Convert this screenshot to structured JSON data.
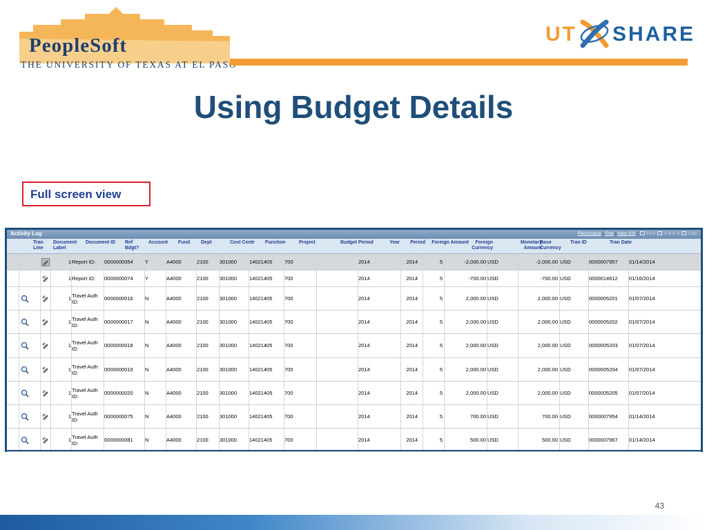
{
  "header": {
    "peoplesoft": "PeopleSoft",
    "university": "THE UNIVERSITY OF TEXAS AT EL PASO",
    "ut_share_left": "UT",
    "ut_share_right": "SHARE"
  },
  "title": "Using Budget Details",
  "callout": "Full screen view",
  "grid": {
    "title": "Activity Log",
    "nav": {
      "personalize": "Personalize",
      "find": "Find",
      "view": "View 100",
      "first": "First",
      "range": "1-9 of 9",
      "last": "Last"
    },
    "columns": [
      "Tran Line",
      "Document Label",
      "Document ID",
      "Ref Bdgt?",
      "Account",
      "Fund",
      "Dept",
      "Cost Centr",
      "Function",
      "Project",
      "Budget Period",
      "Year",
      "Period",
      "Foreign Amount",
      "Foreign Currency",
      "Monetary Amount",
      "Base Currency",
      "Tran ID",
      "Tran Date"
    ],
    "rows": [
      {
        "tran_line": "1",
        "label": "Report ID:",
        "doc_id": "0000000054",
        "ref": "Y",
        "account": "A4000",
        "fund": "2100",
        "dept": "301000",
        "cost": "14021405",
        "function": "700",
        "project": "",
        "budget_period": "2014",
        "year": "2014",
        "period": "5",
        "foreign_amount": "-2,000.00",
        "foreign_currency": "USD",
        "monetary_amount": "-2,000.00",
        "base_currency": "USD",
        "tran_id": "0000007957",
        "tran_date": "01/14/2014"
      },
      {
        "tran_line": "1",
        "label": "Report ID:",
        "doc_id": "0000000074",
        "ref": "Y",
        "account": "A4000",
        "fund": "2100",
        "dept": "301000",
        "cost": "14021405",
        "function": "700",
        "project": "",
        "budget_period": "2014",
        "year": "2014",
        "period": "5",
        "foreign_amount": "-700.00",
        "foreign_currency": "USD",
        "monetary_amount": "-700.00",
        "base_currency": "USD",
        "tran_id": "0000014612",
        "tran_date": "01/16/2014"
      },
      {
        "tran_line": "1",
        "label": "Travel Auth ID:",
        "doc_id": "0000000016",
        "ref": "N",
        "account": "A4000",
        "fund": "2100",
        "dept": "301000",
        "cost": "14021405",
        "function": "700",
        "project": "",
        "budget_period": "2014",
        "year": "2014",
        "period": "5",
        "foreign_amount": "2,000.00",
        "foreign_currency": "USD",
        "monetary_amount": "2,000.00",
        "base_currency": "USD",
        "tran_id": "0000005201",
        "tran_date": "01/07/2014"
      },
      {
        "tran_line": "1",
        "label": "Travel Auth ID:",
        "doc_id": "0000000017",
        "ref": "N",
        "account": "A4000",
        "fund": "2100",
        "dept": "301000",
        "cost": "14021405",
        "function": "700",
        "project": "",
        "budget_period": "2014",
        "year": "2014",
        "period": "5",
        "foreign_amount": "2,000.00",
        "foreign_currency": "USD",
        "monetary_amount": "2,000.00",
        "base_currency": "USD",
        "tran_id": "0000005202",
        "tran_date": "01/07/2014"
      },
      {
        "tran_line": "1",
        "label": "Travel Auth ID:",
        "doc_id": "0000000018",
        "ref": "N",
        "account": "A4000",
        "fund": "2100",
        "dept": "301000",
        "cost": "14021405",
        "function": "700",
        "project": "",
        "budget_period": "2014",
        "year": "2014",
        "period": "5",
        "foreign_amount": "2,000.00",
        "foreign_currency": "USD",
        "monetary_amount": "2,000.00",
        "base_currency": "USD",
        "tran_id": "0000005203",
        "tran_date": "01/07/2014"
      },
      {
        "tran_line": "1",
        "label": "Travel Auth ID:",
        "doc_id": "0000000019",
        "ref": "N",
        "account": "A4000",
        "fund": "2100",
        "dept": "301000",
        "cost": "14021405",
        "function": "700",
        "project": "",
        "budget_period": "2014",
        "year": "2014",
        "period": "5",
        "foreign_amount": "2,000.00",
        "foreign_currency": "USD",
        "monetary_amount": "2,000.00",
        "base_currency": "USD",
        "tran_id": "0000005204",
        "tran_date": "01/07/2014"
      },
      {
        "tran_line": "1",
        "label": "Travel Auth ID:",
        "doc_id": "0000000020",
        "ref": "N",
        "account": "A4000",
        "fund": "2100",
        "dept": "301000",
        "cost": "14021405",
        "function": "700",
        "project": "",
        "budget_period": "2014",
        "year": "2014",
        "period": "5",
        "foreign_amount": "2,000.00",
        "foreign_currency": "USD",
        "monetary_amount": "2,000.00",
        "base_currency": "USD",
        "tran_id": "0000005205",
        "tran_date": "01/07/2014"
      },
      {
        "tran_line": "1",
        "label": "Travel Auth ID:",
        "doc_id": "0000000075",
        "ref": "N",
        "account": "A4000",
        "fund": "2100",
        "dept": "301000",
        "cost": "14021405",
        "function": "700",
        "project": "",
        "budget_period": "2014",
        "year": "2014",
        "period": "5",
        "foreign_amount": "700.00",
        "foreign_currency": "USD",
        "monetary_amount": "700.00",
        "base_currency": "USD",
        "tran_id": "0000007954",
        "tran_date": "01/14/2014"
      },
      {
        "tran_line": "1",
        "label": "Travel Auth ID:",
        "doc_id": "0000000081",
        "ref": "N",
        "account": "A4000",
        "fund": "2100",
        "dept": "301000",
        "cost": "14021405",
        "function": "700",
        "project": "",
        "budget_period": "2014",
        "year": "2014",
        "period": "5",
        "foreign_amount": "500.00",
        "foreign_currency": "USD",
        "monetary_amount": "500.00",
        "base_currency": "USD",
        "tran_id": "0000007967",
        "tran_date": "01/14/2014"
      }
    ]
  },
  "page_number": "43",
  "colors": {
    "title": "#1f4e79",
    "callout_border": "#d81e2a",
    "orange": "#f39c36",
    "grid_header": "#dbe6f3"
  }
}
